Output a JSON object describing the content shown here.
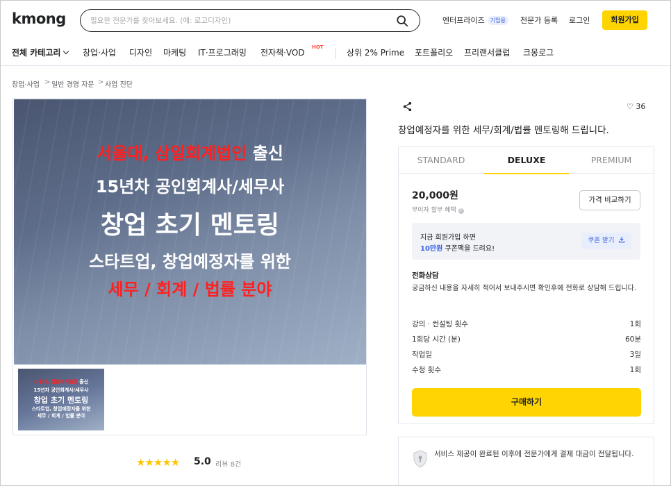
{
  "header": {
    "logo": "kmong",
    "search_placeholder": "필요한 전문가를 찾아보세요. (예: 로고디자인)",
    "enterprise": "엔터프라이즈",
    "enterprise_badge": "기업용",
    "expert_register": "전문가 등록",
    "login": "로그인",
    "join": "회원가입"
  },
  "categories": {
    "all": "전체 카테고리",
    "items": [
      "창업·사업",
      "디자인",
      "마케팅",
      "IT·프로그래밍",
      "전자책·VOD",
      "상위 2% Prime",
      "포트폴리오",
      "프리랜서클럽",
      "크몽로그"
    ],
    "hot_badge": "HOT"
  },
  "breadcrumb": [
    "창업·사업",
    "일반 경영 자문",
    "사업 진단"
  ],
  "main_image": {
    "line1_red": "서울대, 삼일회계법인",
    "line1_white": " 출신",
    "line2": "15년차 공인회계사/세무사",
    "line3": "창업 초기 멘토링",
    "line4": "스타트업, 창업예정자를 위한",
    "line5": "세무 / 회계 / 법률 분야"
  },
  "rating": {
    "stars": "★★★★★",
    "score": "5.0",
    "reviews": "리뷰 8건"
  },
  "gig": {
    "likes": "36",
    "title": "창업예정자를 위한 세무/회계/법률 멘토링해 드립니다."
  },
  "package": {
    "tabs": [
      "STANDARD",
      "DELUXE",
      "PREMIUM"
    ],
    "active_tab": "DELUXE",
    "price": "20,000원",
    "no_interest": "무이자 할부 혜택",
    "compare": "가격 비교하기",
    "coupon_line1": "지금 회원가입 하면",
    "coupon_amount": "10만원",
    "coupon_line2_rest": " 쿠폰팩을 드려요!",
    "coupon_button": "쿠폰 받기",
    "desc_title": "전화상담",
    "desc": "궁금하신 내용을 자세히 적어서 보내주시면 확인후에 전화로 상담해 드립니다.",
    "specs": [
      {
        "label": "강의 · 컨설팅 횟수",
        "value": "1회"
      },
      {
        "label": "1회당 시간 (분)",
        "value": "60분"
      },
      {
        "label": "작업일",
        "value": "3일"
      },
      {
        "label": "수정 횟수",
        "value": "1회"
      }
    ],
    "buy": "구매하기"
  },
  "safe_pay": "서비스 제공이 완료된 이후에 전문가에게 결제 대금이 전달됩니다."
}
